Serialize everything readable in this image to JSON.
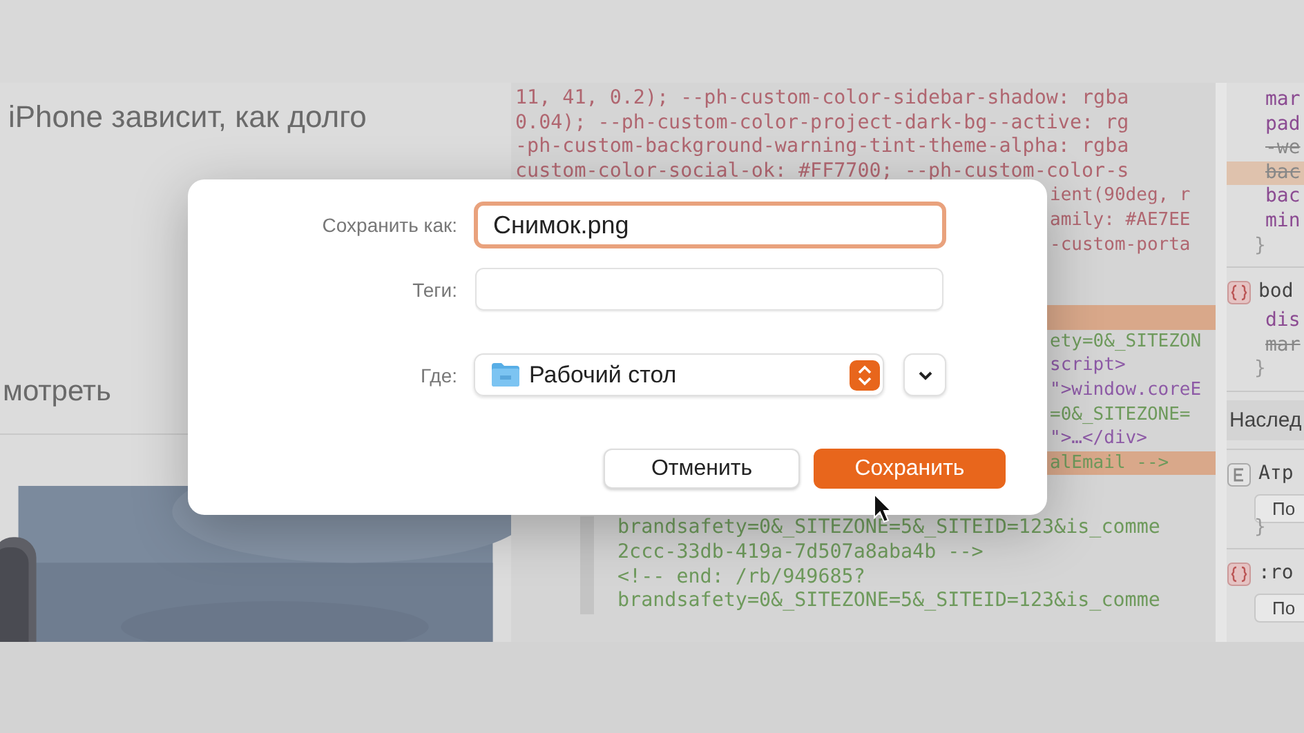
{
  "page": {
    "headline": "iPhone зависит, как долго",
    "link": "мотреть"
  },
  "code": {
    "top_lines": [
      {
        "text": "11, 41, 0.2); --ph-custom-color-sidebar-shadow: rgba",
        "kind": "css"
      },
      {
        "text": "0.04); --ph-custom-color-project-dark-bg--active: rg",
        "kind": "css"
      },
      {
        "text": "-ph-custom-background-warning-tint-theme-alpha: rgba",
        "kind": "css"
      },
      {
        "text": "custom-color-social-ok: #FF7700; --ph-custom-color-s",
        "kind": "css"
      }
    ],
    "side_upper": [
      {
        "text": "ient(90deg, r",
        "kind": "css",
        "highlighted": false
      },
      {
        "text": "amily: #AE7EE",
        "kind": "css",
        "highlighted": false
      },
      {
        "text": "-custom-porta",
        "kind": "css",
        "highlighted": false
      }
    ],
    "side_lower": [
      {
        "kind": "blank",
        "highlighted": true
      },
      {
        "text": "ety=0&_SITEZON",
        "kind": "html",
        "highlighted": false
      },
      {
        "text": "script>",
        "kind": "tag",
        "highlighted": false
      },
      {
        "text": "\">window.coreE",
        "kind": "tag",
        "highlighted": false
      },
      {
        "text": "=0&_SITEZONE=",
        "kind": "html",
        "highlighted": false
      },
      {
        "text": "\">…</div>",
        "kind": "tag",
        "highlighted": false
      },
      {
        "text": "alEmail -->",
        "kind": "html",
        "highlighted": true
      }
    ],
    "bottom_lines": [
      {
        "text": "brandsafety=0&_SITEZONE=5&_SITEID=123&is_comme",
        "kind": "html"
      },
      {
        "text": "2ccc-33db-419a-7d507a8aba4b -->",
        "kind": "html"
      },
      {
        "text": "<!-- end: /rb/949685?",
        "kind": "html"
      },
      {
        "text": "brandsafety=0&_SITEZONE=5&_SITEID=123&is_comme",
        "kind": "html"
      }
    ]
  },
  "styles": [
    {
      "kind": "prop",
      "text": "mar"
    },
    {
      "kind": "prop",
      "text": "pad"
    },
    {
      "kind": "struck",
      "text": "-we"
    },
    {
      "kind": "struck_warn",
      "text": "bac"
    },
    {
      "kind": "prop",
      "text": "bac"
    },
    {
      "kind": "prop",
      "text": "min"
    },
    {
      "kind": "brace",
      "text": "}"
    },
    {
      "kind": "rule",
      "text": "bod"
    },
    {
      "kind": "prop",
      "text": "dis"
    },
    {
      "kind": "struck",
      "text": "mar"
    },
    {
      "kind": "brace",
      "text": "}"
    },
    {
      "kind": "header",
      "text": "Наслед"
    },
    {
      "kind": "attr",
      "text": "Атр"
    },
    {
      "kind": "button",
      "text": "По"
    },
    {
      "kind": "brace",
      "text": "}"
    },
    {
      "kind": "rule",
      "text": ":ro"
    },
    {
      "kind": "button",
      "text": "По"
    }
  ],
  "dialog": {
    "save_as": {
      "label": "Сохранить как:",
      "value": "Снимок.png",
      "focused": true
    },
    "tags": {
      "label": "Теги:"
    },
    "where": {
      "label": "Где:",
      "value": "Рабочий стол"
    },
    "buttons": [
      {
        "label": "Отменить",
        "kind": "secondary"
      },
      {
        "label": "Сохранить",
        "kind": "primary"
      }
    ]
  }
}
